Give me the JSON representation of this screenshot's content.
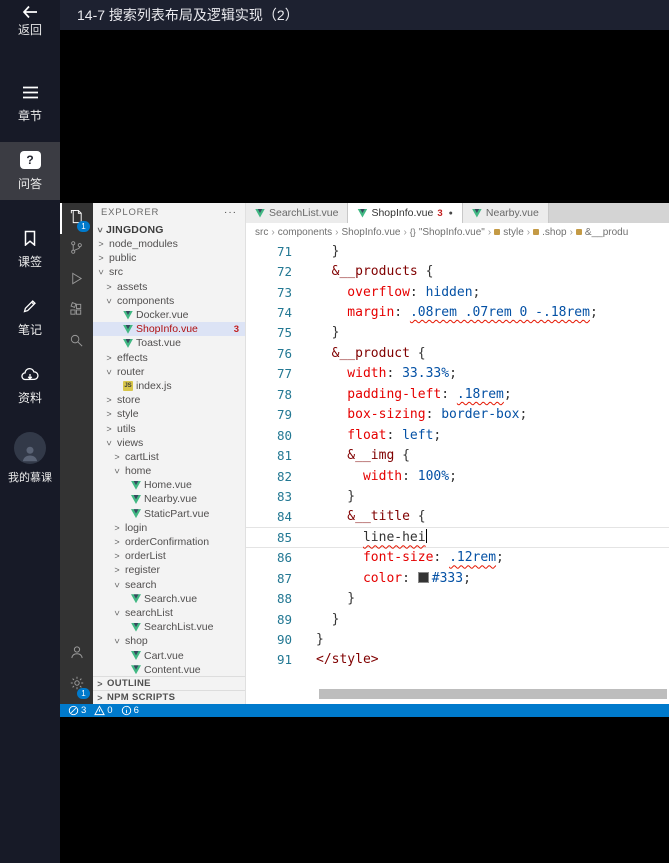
{
  "player": {
    "title": "14-7 搜索列表布局及逻辑实现（2）",
    "back": {
      "label": "返回"
    },
    "nav": [
      {
        "id": "chapters",
        "label": "章节"
      },
      {
        "id": "qa",
        "label": "问答",
        "active": true,
        "icon_text": "?"
      },
      {
        "id": "bookmarks",
        "label": "课签"
      },
      {
        "id": "notes",
        "label": "笔记"
      },
      {
        "id": "materials",
        "label": "资料"
      },
      {
        "id": "mymooc",
        "label": "我的慕课"
      }
    ]
  },
  "vscode": {
    "activity_bar": {
      "top": [
        {
          "id": "explorer",
          "active": true,
          "badge": "1"
        },
        {
          "id": "source-control"
        },
        {
          "id": "debug"
        },
        {
          "id": "extensions"
        },
        {
          "id": "search"
        }
      ],
      "bottom": [
        {
          "id": "account"
        },
        {
          "id": "settings",
          "badge": "1"
        }
      ]
    },
    "explorer": {
      "title": "EXPLORER",
      "root": "JINGDONG",
      "items": [
        {
          "label": "node_modules",
          "d": 1,
          "k": "folder",
          "e": false
        },
        {
          "label": "public",
          "d": 1,
          "k": "folder",
          "e": false
        },
        {
          "label": "src",
          "d": 1,
          "k": "folder",
          "e": true
        },
        {
          "label": "assets",
          "d": 2,
          "k": "folder",
          "e": false
        },
        {
          "label": "components",
          "d": 2,
          "k": "folder",
          "e": true
        },
        {
          "label": "Docker.vue",
          "d": 3,
          "k": "file",
          "i": "vue"
        },
        {
          "label": "ShopInfo.vue",
          "d": 3,
          "k": "file",
          "i": "vue",
          "sel": true,
          "badge": "3"
        },
        {
          "label": "Toast.vue",
          "d": 3,
          "k": "file",
          "i": "vue"
        },
        {
          "label": "effects",
          "d": 2,
          "k": "folder",
          "e": false
        },
        {
          "label": "router",
          "d": 2,
          "k": "folder",
          "e": true
        },
        {
          "label": "index.js",
          "d": 3,
          "k": "file",
          "i": "js"
        },
        {
          "label": "store",
          "d": 2,
          "k": "folder",
          "e": false
        },
        {
          "label": "style",
          "d": 2,
          "k": "folder",
          "e": false
        },
        {
          "label": "utils",
          "d": 2,
          "k": "folder",
          "e": false
        },
        {
          "label": "views",
          "d": 2,
          "k": "folder",
          "e": true
        },
        {
          "label": "cartList",
          "d": 3,
          "k": "folder",
          "e": false
        },
        {
          "label": "home",
          "d": 3,
          "k": "folder",
          "e": true
        },
        {
          "label": "Home.vue",
          "d": 4,
          "k": "file",
          "i": "vue"
        },
        {
          "label": "Nearby.vue",
          "d": 4,
          "k": "file",
          "i": "vue"
        },
        {
          "label": "StaticPart.vue",
          "d": 4,
          "k": "file",
          "i": "vue"
        },
        {
          "label": "login",
          "d": 3,
          "k": "folder",
          "e": false
        },
        {
          "label": "orderConfirmation",
          "d": 3,
          "k": "folder",
          "e": false
        },
        {
          "label": "orderList",
          "d": 3,
          "k": "folder",
          "e": false
        },
        {
          "label": "register",
          "d": 3,
          "k": "folder",
          "e": false
        },
        {
          "label": "search",
          "d": 3,
          "k": "folder",
          "e": true
        },
        {
          "label": "Search.vue",
          "d": 4,
          "k": "file",
          "i": "vue"
        },
        {
          "label": "searchList",
          "d": 3,
          "k": "folder",
          "e": true
        },
        {
          "label": "SearchList.vue",
          "d": 4,
          "k": "file",
          "i": "vue"
        },
        {
          "label": "shop",
          "d": 3,
          "k": "folder",
          "e": true
        },
        {
          "label": "Cart.vue",
          "d": 4,
          "k": "file",
          "i": "vue"
        },
        {
          "label": "Content.vue",
          "d": 4,
          "k": "file",
          "i": "vue"
        }
      ],
      "sections": [
        {
          "label": "OUTLINE"
        },
        {
          "label": "NPM SCRIPTS"
        }
      ]
    },
    "tabs": [
      {
        "label": "SearchList.vue"
      },
      {
        "label": "ShopInfo.vue",
        "badge": "3",
        "active": true,
        "modified": true
      },
      {
        "label": "Nearby.vue"
      }
    ],
    "breadcrumbs": [
      {
        "label": "src"
      },
      {
        "label": "components"
      },
      {
        "label": "ShopInfo.vue"
      },
      {
        "label": "\"ShopInfo.vue\"",
        "icon": "braces"
      },
      {
        "label": "style",
        "icon": "symbol"
      },
      {
        "label": ".shop",
        "icon": "symbol"
      },
      {
        "label": "&__produ",
        "icon": "symbol"
      }
    ],
    "code": {
      "lines": [
        {
          "n": "71",
          "t": [
            [
              "p",
              "  }"
            ]
          ]
        },
        {
          "n": "72",
          "t": [
            [
              "sel",
              "  &__products"
            ],
            [
              "p",
              " {"
            ]
          ]
        },
        {
          "n": "73",
          "t": [
            [
              "prop",
              "    overflow"
            ],
            [
              "p",
              ": "
            ],
            [
              "val",
              "hidden"
            ],
            [
              "p",
              ";"
            ]
          ]
        },
        {
          "n": "74",
          "t": [
            [
              "prop",
              "    margin"
            ],
            [
              "p",
              ": "
            ],
            [
              "val sq",
              ".08rem .07rem 0 -.18rem"
            ],
            [
              "p",
              ";"
            ]
          ]
        },
        {
          "n": "75",
          "t": [
            [
              "p",
              "  }"
            ]
          ]
        },
        {
          "n": "76",
          "t": [
            [
              "sel",
              "  &__product"
            ],
            [
              "p",
              " {"
            ]
          ]
        },
        {
          "n": "77",
          "t": [
            [
              "prop",
              "    width"
            ],
            [
              "p",
              ": "
            ],
            [
              "val",
              "33.33%"
            ],
            [
              "p",
              ";"
            ]
          ]
        },
        {
          "n": "78",
          "t": [
            [
              "prop",
              "    padding-left"
            ],
            [
              "p",
              ": "
            ],
            [
              "val sq",
              ".18rem"
            ],
            [
              "p",
              ";"
            ]
          ]
        },
        {
          "n": "79",
          "t": [
            [
              "prop",
              "    box-sizing"
            ],
            [
              "p",
              ": "
            ],
            [
              "val",
              "border-box"
            ],
            [
              "p",
              ";"
            ]
          ]
        },
        {
          "n": "80",
          "t": [
            [
              "prop",
              "    float"
            ],
            [
              "p",
              ": "
            ],
            [
              "val",
              "left"
            ],
            [
              "p",
              ";"
            ]
          ]
        },
        {
          "n": "81",
          "t": [
            [
              "sel",
              "    &__img"
            ],
            [
              "p",
              " {"
            ]
          ]
        },
        {
          "n": "82",
          "t": [
            [
              "prop",
              "      width"
            ],
            [
              "p",
              ": "
            ],
            [
              "val",
              "100%"
            ],
            [
              "p",
              ";"
            ]
          ]
        },
        {
          "n": "83",
          "t": [
            [
              "p",
              "    }"
            ]
          ]
        },
        {
          "n": "84",
          "t": [
            [
              "sel",
              "    &__title"
            ],
            [
              "p",
              " {"
            ]
          ]
        },
        {
          "n": "85",
          "cur": true,
          "t": [
            [
              "p",
              "      "
            ],
            [
              "p sq",
              "line-hei"
            ],
            [
              "cursor",
              ""
            ]
          ]
        },
        {
          "n": "86",
          "t": [
            [
              "prop",
              "      font-size"
            ],
            [
              "p",
              ": "
            ],
            [
              "val sq",
              ".12rem"
            ],
            [
              "p",
              ";"
            ]
          ]
        },
        {
          "n": "87",
          "t": [
            [
              "prop",
              "      color"
            ],
            [
              "p",
              ": "
            ],
            [
              "swatch",
              ""
            ],
            [
              "val",
              "#333"
            ],
            [
              "p",
              ";"
            ]
          ]
        },
        {
          "n": "88",
          "t": [
            [
              "p",
              "    }"
            ]
          ]
        },
        {
          "n": "89",
          "t": [
            [
              "p",
              "  }"
            ]
          ]
        },
        {
          "n": "90",
          "t": [
            [
              "p",
              "}"
            ]
          ]
        },
        {
          "n": "91",
          "t": [
            [
              "tag",
              "</style>"
            ]
          ]
        }
      ]
    },
    "status_bar": {
      "items": [
        {
          "icon": "error",
          "value": "3"
        },
        {
          "icon": "warning",
          "value": "0"
        },
        {
          "icon": "info",
          "value": "6"
        }
      ]
    }
  }
}
